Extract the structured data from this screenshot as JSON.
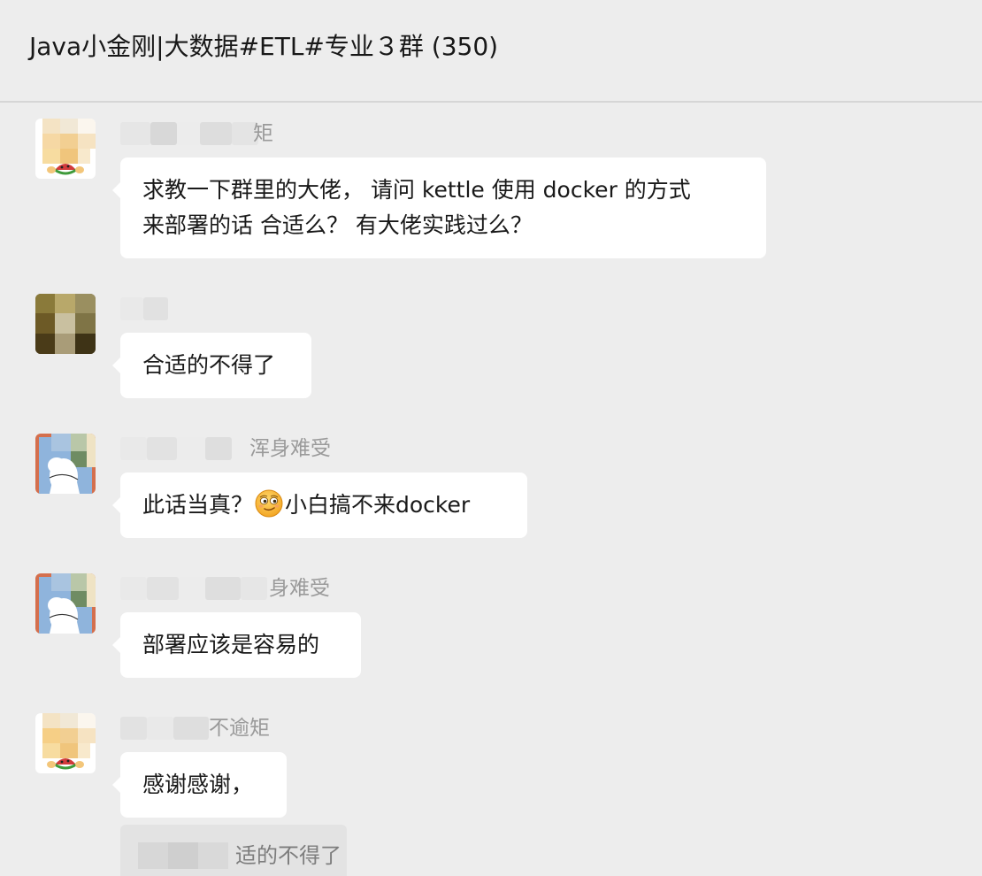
{
  "header": {
    "title": "Java小金刚|大数据#ETL#专业３群 (350)"
  },
  "messages": [
    {
      "sender_visible": "矩",
      "text_lines": [
        "求教一下群里的大佬， 请问 kettle 使用 docker 的方式",
        "来部署的话 合适么？   有大佬实践过么？"
      ],
      "avatar": "cartoon-watermelon-avatar"
    },
    {
      "sender_visible": "",
      "text_lines": [
        "合适的不得了"
      ],
      "avatar": "photo-avatar"
    },
    {
      "sender_visible": "浑身难受",
      "text_before_emoji": "此话当真？",
      "emoji": "smirking-face-emoji",
      "text_after_emoji": "小白搞不来docker",
      "avatar": "cartoon-sheep-avatar"
    },
    {
      "sender_visible": "身难受",
      "text_lines": [
        "部署应该是容易的"
      ],
      "avatar": "cartoon-sheep-avatar"
    },
    {
      "sender_visible": "不逾矩",
      "text_lines": [
        "感谢感谢，"
      ],
      "avatar": "cartoon-watermelon-avatar"
    }
  ],
  "quote": {
    "visible_text": "适的不得了"
  },
  "colors": {
    "background": "#ededed",
    "bubble": "#ffffff",
    "sender": "#9a9a9a",
    "quote_bg": "#e3e3e3"
  }
}
